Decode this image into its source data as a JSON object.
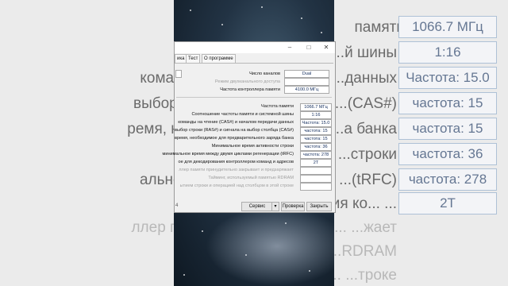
{
  "background": {
    "rows": [
      {
        "label": "",
        "value": "1066.7 МГц"
      },
      {
        "label": "Соотношение часто... ...й шины",
        "value": "1:16"
      },
      {
        "label": "команды на чтение (CAS...  ...данных",
        "value": "Частота: 15.0"
      },
      {
        "label": "выбор строки (RAS#) и сиг... ...(CAS#)",
        "value": "частота: 15"
      },
      {
        "label": "ремя, необходимое для пр... ...а банка",
        "value": "частота: 15"
      },
      {
        "label": "Минимал... ...строки",
        "value": "частота: 36"
      },
      {
        "label": "альное время между двух... ...(tRFC)",
        "value": "частота: 278"
      },
      {
        "label": "ое для декодирования ко... ...",
        "value": "2T"
      },
      {
        "label": "ллер памяти принудительно ... ...жает",
        "value": ""
      },
      {
        "label": "Тайминг, и... ...RDRAM",
        "value": ""
      },
      {
        "label": "строки и операци... ...троке",
        "value": ""
      }
    ],
    "top_right_text": "памяти"
  },
  "window": {
    "tabs": [
      "ика",
      "Тест",
      "О программе"
    ],
    "channels_label": "Число каналов",
    "channels_value": "Dual",
    "dual_mode_label": "Режим двухканального доступа",
    "dual_mode_value": "",
    "controller_freq_label": "Частота контроллера памяти",
    "controller_freq_value": "4100.0 МГц",
    "timings": [
      {
        "label": "Частота памяти",
        "value": "1066.7 МГц",
        "gray": false
      },
      {
        "label": "Соотношение частоты памяти и системной шины",
        "value": "1:16",
        "gray": false
      },
      {
        "label": "команды на чтение (CAS#) и началом передачи данных",
        "value": "Частота: 15.0",
        "gray": false
      },
      {
        "label": "выбор строки (RAS#) и сигнала на выбор столбца (CAS#)",
        "value": "частота: 15",
        "gray": false
      },
      {
        "label": "время, необходимое для предварительного заряда банка",
        "value": "частота: 15",
        "gray": false
      },
      {
        "label": "Минимальное время активности строки",
        "value": "частота: 36",
        "gray": false
      },
      {
        "label": "минимальное время между двумя циклами регенерации (tRFC)",
        "value": "частота: 278",
        "gray": false
      },
      {
        "label": "ое для декодирования контроллером команд и адресов",
        "value": "2T",
        "gray": false
      },
      {
        "label": "ллер памяти принудительно закрывает и предзаряжает",
        "value": "",
        "gray": true
      },
      {
        "label": "Тайминг, используемый памятью RDRAM",
        "value": "",
        "gray": true
      },
      {
        "label": "ытием строки и операцией над столбцом в этой строке",
        "value": "",
        "gray": true
      }
    ],
    "version": "4",
    "service_button": "Сервис",
    "check_button": "Проверка",
    "close_button": "Закрыть"
  }
}
